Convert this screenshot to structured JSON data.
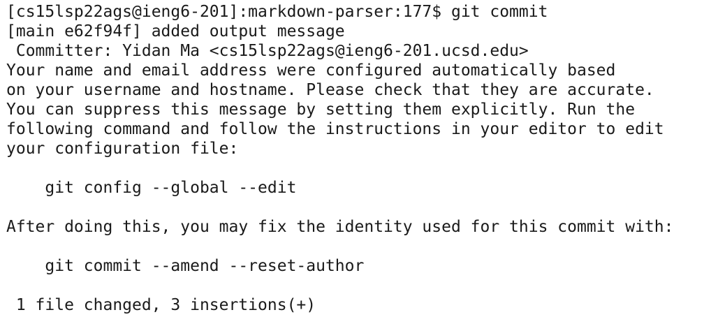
{
  "terminal": {
    "accent_color": "#b8b82a",
    "lines": [
      "[cs15lsp22ags@ieng6-201]:markdown-parser:177$ git commit",
      "[main e62f94f] added output message",
      " Committer: Yidan Ma <cs15lsp22ags@ieng6-201.ucsd.edu>",
      "Your name and email address were configured automatically based",
      "on your username and hostname. Please check that they are accurate.",
      "You can suppress this message by setting them explicitly. Run the",
      "following command and follow the instructions in your editor to edit",
      "your configuration file:",
      "",
      "    git config --global --edit",
      "",
      "After doing this, you may fix the identity used for this commit with:",
      "",
      "    git commit --amend --reset-author",
      "",
      " 1 file changed, 3 insertions(+)"
    ]
  }
}
